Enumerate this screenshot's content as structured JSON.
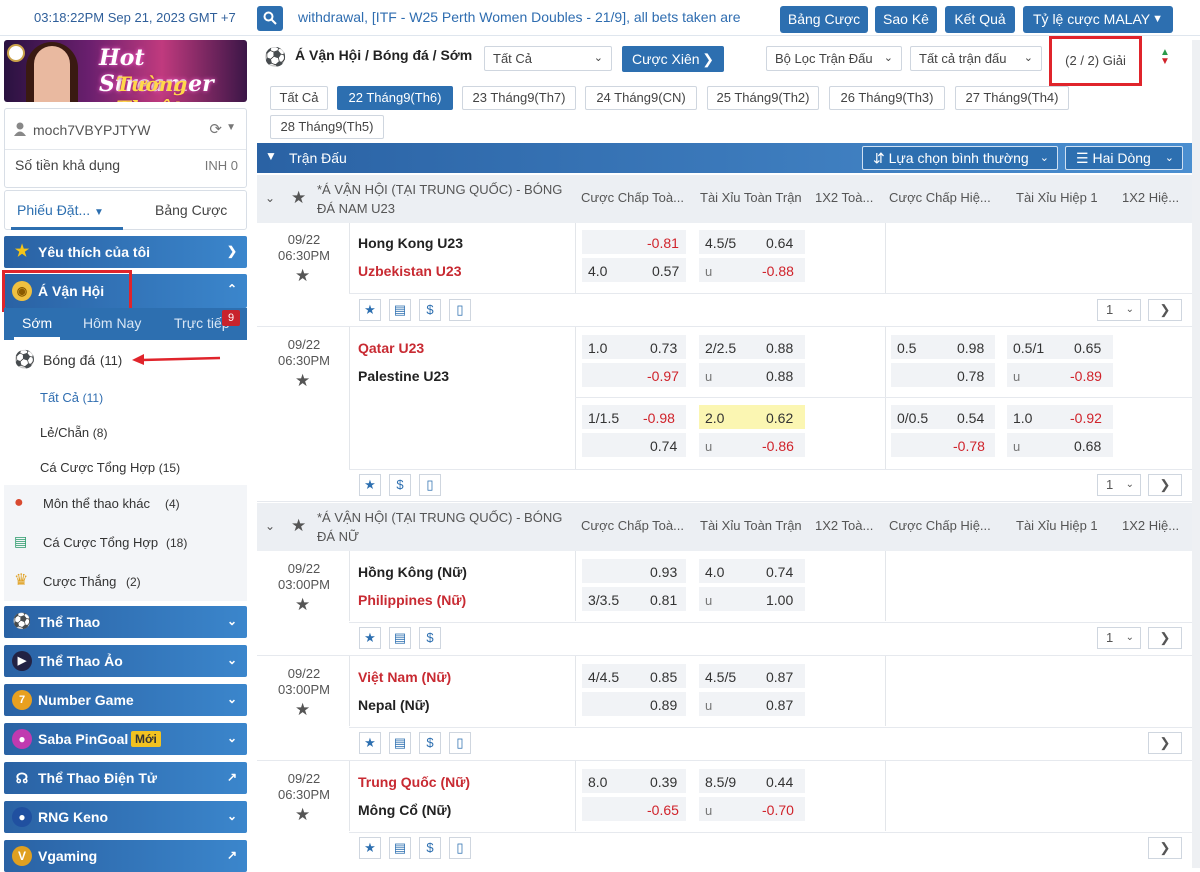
{
  "topbar": {
    "clock": "03:18:22PM Sep 21, 2023 GMT +7",
    "ticker": "withdrawal, [ITF - W25 Perth Women Doubles - 21/9], all bets taken are",
    "buttons": [
      "Bảng Cược",
      "Sao Kê",
      "Kết Quả",
      "Tỷ lệ cược MALAY"
    ]
  },
  "banner": {
    "line1": "Hot Streamer",
    "line2": "Tường Thuật"
  },
  "user": {
    "name": "moch7VBYPJTYW",
    "balance_label": "Số tiền khả dụng",
    "balance_value": "INH 0"
  },
  "sidetabs": {
    "tab1": "Phiếu Đặt...",
    "tab2": "Bảng Cược"
  },
  "nav": {
    "favorites": "Yêu thích của tôi",
    "asiad": "Á Vận Hội",
    "subtabs": [
      "Sớm",
      "Hôm Nay",
      "Trực tiếp"
    ],
    "live_count": "9",
    "football": "Bóng đá",
    "football_count": "(11)",
    "subs": [
      {
        "label": "Tất Cả",
        "count": "(11)"
      },
      {
        "label": "Lẻ/Chẵn",
        "count": "(8)"
      },
      {
        "label": "Cá Cược Tổng Hợp",
        "count": "(15)"
      }
    ],
    "other": [
      {
        "label": "Môn thể thao khác",
        "count": "(4)"
      },
      {
        "label": "Cá Cược Tổng Hợp",
        "count": "(18)"
      },
      {
        "label": "Cược Thắng",
        "count": "(2)"
      }
    ],
    "sections": [
      "Thể Thao",
      "Thể Thao Ảo",
      "Number Game",
      "Saba PinGoal",
      "Thể Thao Điện Tử",
      "RNG Keno",
      "Vgaming"
    ],
    "new_badge": "Mới"
  },
  "filters": {
    "crumb": "Á Vận Hội / Bóng đá / Sớm",
    "all": "Tất Cả",
    "parlay": "Cược Xiên",
    "match_filter": "Bộ Lọc Trận Đấu",
    "all_matches": "Tất cả trận đấu",
    "leagues": "(2 / 2) Giải"
  },
  "dates": [
    "Tất Cả",
    "22 Tháng9(Th6)",
    "23 Tháng9(Th7)",
    "24 Tháng9(CN)",
    "25 Tháng9(Th2)",
    "26 Tháng9(Th3)",
    "27 Tháng9(Th4)",
    "28 Tháng9(Th5)"
  ],
  "header": {
    "title": "Trận Đấu",
    "sort": "Lựa chọn bình thường",
    "lines": "Hai Dòng"
  },
  "columns": [
    "Cược Chấp Toà...",
    "Tài Xỉu Toàn Trận",
    "1X2 Toà...",
    "Cược Chấp Hiệ...",
    "Tài Xỉu Hiệp 1",
    "1X2 Hiệ..."
  ],
  "leagues": [
    {
      "name": "*Á VẬN HỘI (TẠI TRUNG QUỐC) - BÓNG ĐÁ NAM U23"
    },
    {
      "name": "*Á VẬN HỘI (TẠI TRUNG QUỐC) - BÓNG ĐÁ NỮ"
    }
  ],
  "matches": [
    {
      "date": "09/22",
      "time": "06:30PM",
      "home": "Hong Kong U23",
      "away": "Uzbekistan U23",
      "hcp": [
        "",
        "-0.81",
        "4.0",
        "0.57"
      ],
      "ou": [
        "4.5/5",
        "0.64",
        "u",
        "-0.88"
      ],
      "page": "1"
    },
    {
      "date": "09/22",
      "time": "06:30PM",
      "home": "Qatar U23",
      "away": "Palestine U23",
      "hcp": [
        "1.0",
        "0.73",
        "",
        "-0.97"
      ],
      "ou": [
        "2/2.5",
        "0.88",
        "u",
        "0.88"
      ],
      "h1hcp": [
        "0.5",
        "0.98",
        "",
        "0.78"
      ],
      "h1ou": [
        "0.5/1",
        "0.65",
        "u",
        "-0.89"
      ],
      "hcp2": [
        "1/1.5",
        "-0.98",
        "",
        "0.74"
      ],
      "ou2": [
        "2.0",
        "0.62",
        "u",
        "-0.86"
      ],
      "h1hcp2": [
        "0/0.5",
        "0.54",
        "",
        "-0.78"
      ],
      "h1ou2": [
        "1.0",
        "-0.92",
        "u",
        "0.68"
      ],
      "page": "1"
    },
    {
      "date": "09/22",
      "time": "03:00PM",
      "home": "Hồng Kông (Nữ)",
      "away": "Philippines (Nữ)",
      "hcp": [
        "",
        "0.93",
        "3/3.5",
        "0.81"
      ],
      "ou": [
        "4.0",
        "0.74",
        "u",
        "1.00"
      ],
      "page": "1"
    },
    {
      "date": "09/22",
      "time": "03:00PM",
      "home": "Việt Nam (Nữ)",
      "away": "Nepal (Nữ)",
      "hcp": [
        "4/4.5",
        "0.85",
        "",
        "0.89"
      ],
      "ou": [
        "4.5/5",
        "0.87",
        "u",
        "0.87"
      ]
    },
    {
      "date": "09/22",
      "time": "06:30PM",
      "home": "Trung Quốc (Nữ)",
      "away": "Mông Cổ (Nữ)",
      "hcp": [
        "8.0",
        "0.39",
        "",
        "-0.65"
      ],
      "ou": [
        "8.5/9",
        "0.44",
        "u",
        "-0.70"
      ]
    }
  ],
  "colors": {
    "primary": "#2d6fb0",
    "negative": "#d0232b",
    "highlight": "#e0242b"
  }
}
